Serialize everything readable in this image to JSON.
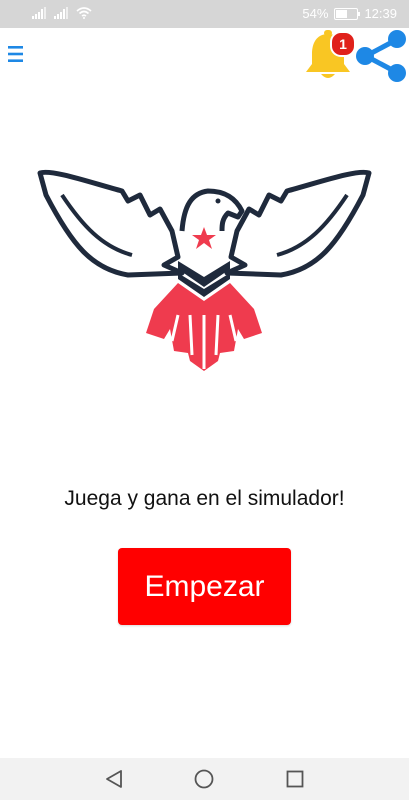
{
  "status_bar": {
    "battery_percent": "54%",
    "battery_level": 0.54,
    "time": "12:39",
    "icons": [
      "signal-icon",
      "signal-icon",
      "wifi-icon",
      "battery-icon"
    ]
  },
  "app_bar": {
    "menu_icon": "hamburger-menu-icon",
    "notification_icon": "bell-icon",
    "notification_count": "1",
    "share_icon": "share-icon"
  },
  "hero": {
    "logo_icon": "eagle-logo",
    "tagline": "Juega y gana en el simulador!",
    "start_label": "Empezar"
  },
  "nav_bar": {
    "icons": [
      "back-triangle-icon",
      "home-circle-icon",
      "recents-square-icon"
    ]
  },
  "colors": {
    "accent_blue": "#1e88e5",
    "button_red": "#ff0000",
    "bell_yellow": "#f9c623",
    "badge_red": "#e0211b",
    "logo_navy": "#1f2a3c",
    "logo_red": "#ef3b4e"
  }
}
